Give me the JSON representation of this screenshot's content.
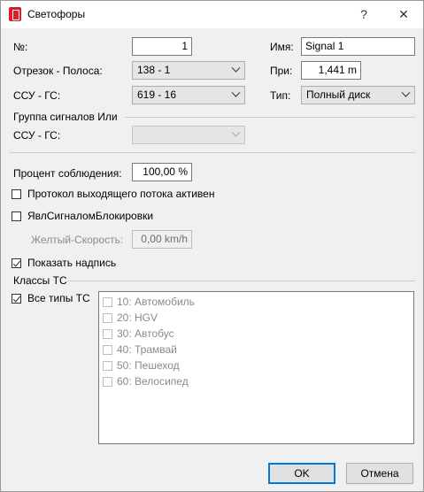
{
  "window": {
    "title": "Светофоры",
    "help": "?",
    "close": "✕"
  },
  "form": {
    "number_label": "№:",
    "number_value": "1",
    "name_label": "Имя:",
    "name_value": "Signal 1",
    "segment_label": "Отрезок - Полоса:",
    "segment_value": "138 - 1",
    "at_label": "При:",
    "at_value": "1,441 m",
    "ssu_label": "ССУ - ГС:",
    "ssu_value": "619 - 16",
    "type_label": "Тип:",
    "type_value": "Полный диск"
  },
  "group_or": {
    "heading": "Группа сигналов Или",
    "ssu_label": "ССУ - ГС:",
    "ssu_value": ""
  },
  "compliance": {
    "label": "Процент соблюдения:",
    "value": "100,00 %"
  },
  "checks": {
    "outflow_protocol": {
      "label": "Протокол выходящего потока активен",
      "checked": false
    },
    "block_signal": {
      "label": "ЯвлСигналомБлокировки",
      "checked": false
    },
    "yellow_speed_label": "Желтый-Скорость:",
    "yellow_speed_value": "0,00 km/h",
    "show_label": {
      "label": "Показать надпись",
      "checked": true
    }
  },
  "vehicle_classes": {
    "heading": "Классы ТС",
    "all_types": {
      "label": "Все типы ТС",
      "checked": true
    },
    "items": [
      {
        "label": "10: Автомобиль",
        "checked": false
      },
      {
        "label": "20: HGV",
        "checked": false
      },
      {
        "label": "30: Автобус",
        "checked": false
      },
      {
        "label": "40: Трамвай",
        "checked": false
      },
      {
        "label": "50: Пешеход",
        "checked": false
      },
      {
        "label": "60: Велосипед",
        "checked": false
      }
    ]
  },
  "buttons": {
    "ok": "OK",
    "cancel": "Отмена"
  },
  "icons": {
    "app": "traffic-light-icon",
    "close": "close-icon",
    "help": "help-icon"
  }
}
